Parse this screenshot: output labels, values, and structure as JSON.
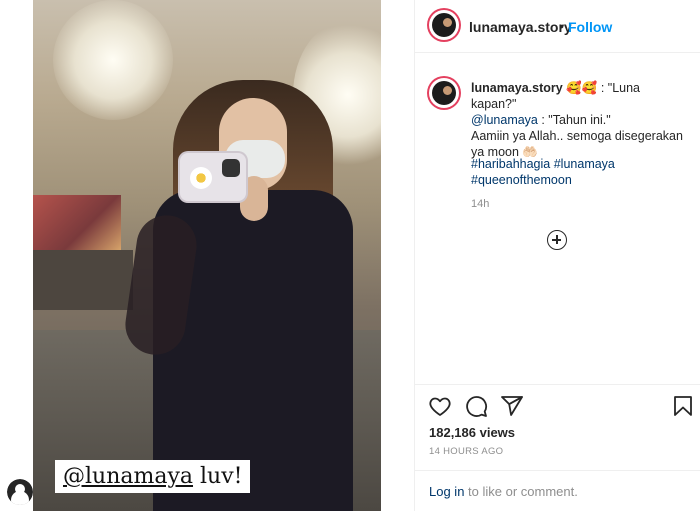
{
  "post": {
    "username": "lunamaya.story",
    "follow_label": "Follow",
    "header_separator": "•",
    "caption_overlay_mention": "@lunamaya",
    "caption_overlay_rest": " luv!"
  },
  "comment": {
    "username": "lunamaya.story",
    "emoji": "🥰🥰",
    "line1": " : \"Luna kapan?\"",
    "mention": "@lunamaya",
    "line2": " : \"Tahun ini.\"",
    "line3": "Aamiin ya Allah.. semoga disegerakan ya moon",
    "line3_emoji": " 🤲🏻",
    "hashtags": [
      "#haribahhagia",
      "#lunamaya",
      "#queenofthemoon"
    ],
    "time": "14h"
  },
  "actions": {
    "views": "182,186 views",
    "time": "14 HOURS AGO",
    "login_link": "Log in",
    "login_rest": " to like or comment."
  },
  "icons": [
    "heart-icon",
    "comment-icon",
    "share-icon",
    "bookmark-icon",
    "add-icon",
    "user-avatar-icon"
  ],
  "colors": {
    "accent": "#0095f6",
    "link": "#00376b",
    "muted": "#8e8e8e",
    "story_ring": "#e4405f"
  }
}
